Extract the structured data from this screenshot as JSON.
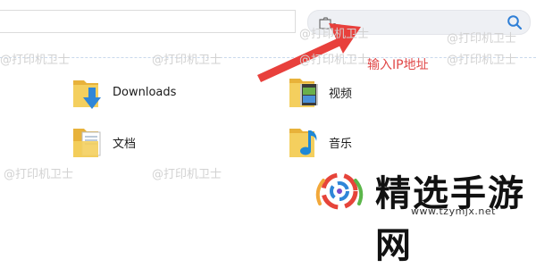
{
  "search": {
    "placeholder": "",
    "value": ""
  },
  "callout": {
    "text": "输入IP地址"
  },
  "watermark": {
    "text": "@打印机卫士"
  },
  "folders": [
    {
      "label": "Downloads",
      "icon": "downloads-folder-icon"
    },
    {
      "label": "视频",
      "icon": "video-folder-icon"
    },
    {
      "label": "文档",
      "icon": "documents-folder-icon"
    },
    {
      "label": "音乐",
      "icon": "music-folder-icon"
    }
  ],
  "logo": {
    "title": "精选手游网",
    "url": "www.tzymjx.net"
  },
  "colors": {
    "arrow": "#e8403c",
    "callout": "#e04848",
    "folder": "#f2c94c",
    "accent": "#2f7fd6"
  }
}
